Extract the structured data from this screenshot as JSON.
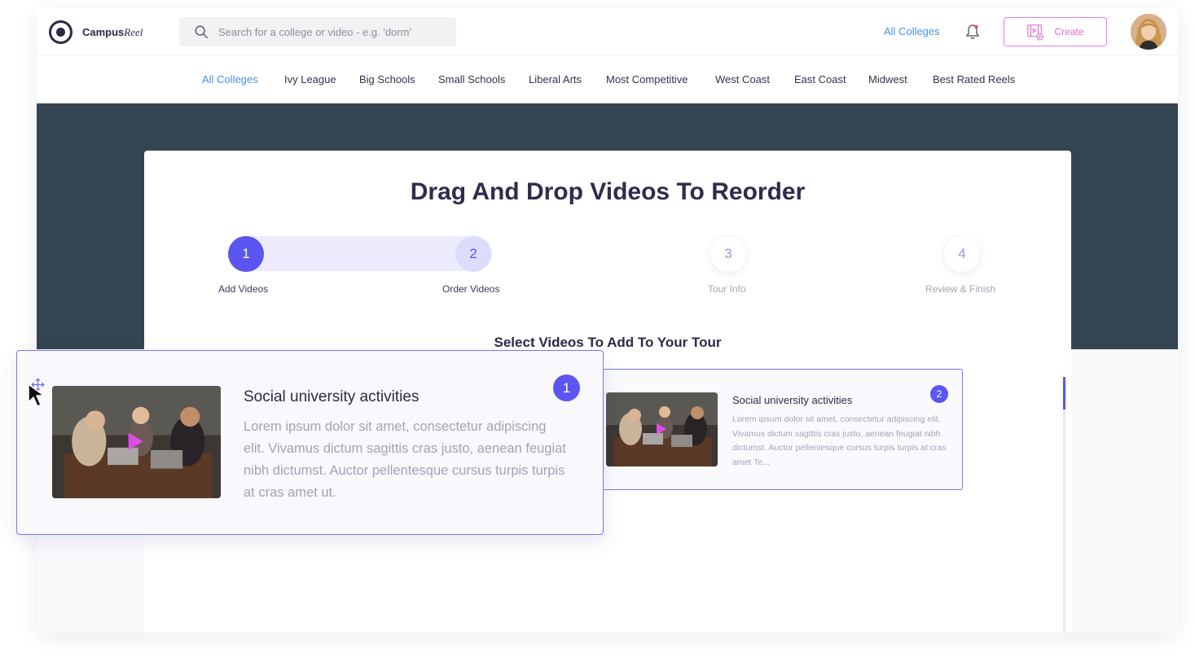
{
  "header": {
    "logo_bold": "Campus",
    "logo_italic": "Reel",
    "search_placeholder": "Search for a college or video - e.g. 'dorm'",
    "all_colleges_link": "All Colleges",
    "create_label": "Create"
  },
  "nav": {
    "items": [
      {
        "label": "All Colleges",
        "active": true
      },
      {
        "label": "Ivy League"
      },
      {
        "label": "Big Schools"
      },
      {
        "label": "Small Schools"
      },
      {
        "label": "Liberal Arts"
      },
      {
        "label": "Most Competitive"
      },
      {
        "label": "West Coast"
      },
      {
        "label": "East Coast"
      },
      {
        "label": "Midwest"
      },
      {
        "label": "Best Rated Reels"
      }
    ]
  },
  "main": {
    "title": "Drag And Drop Videos To Reorder",
    "section_title": "Select Videos To Add To Your Tour",
    "steps": [
      {
        "number": "1",
        "label": "Add Videos"
      },
      {
        "number": "2",
        "label": "Order Videos"
      },
      {
        "number": "3",
        "label": "Tour Info"
      },
      {
        "number": "4",
        "label": "Review & Finish"
      }
    ],
    "videos": [
      {
        "badge": "1",
        "title": "Social university activities",
        "description": "Lorem ipsum dolor sit amet, consectetur adipiscing elit. Vivamus dictum sagittis cras justo, aenean feugiat nibh dictumst. Auctor pellentesque cursus turpis turpis at cras amet ut."
      },
      {
        "badge": "2",
        "title": "Social university activities",
        "description": "Lorem ipsum dolor sit amet, consectetur adipiscing elit. Vivamus dictum sagittis cras justo, aenean feugiat nibh dictumst. Auctor pellentesque cursus turpis turpis at cras amet Te..."
      }
    ]
  },
  "colors": {
    "accent": "#5b55f2",
    "link": "#4a8fe0",
    "create": "#d86ad9",
    "band": "#354552"
  }
}
